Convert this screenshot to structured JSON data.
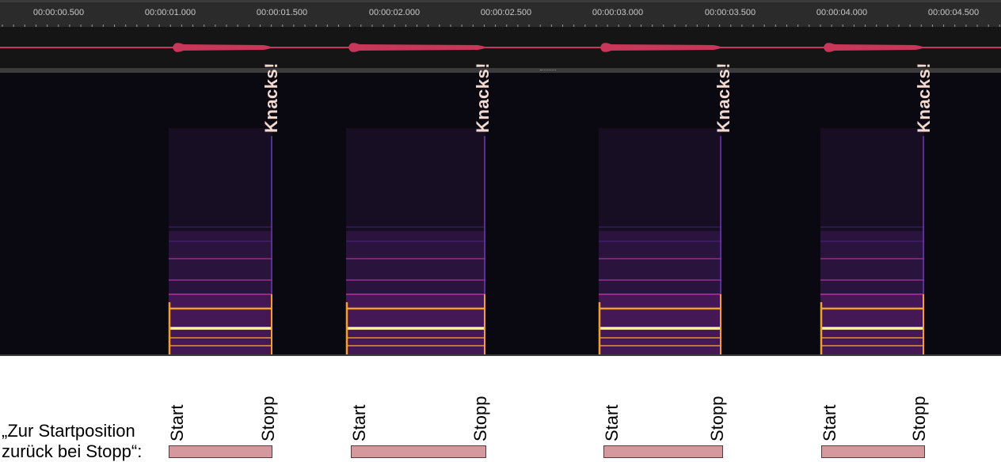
{
  "ruler": {
    "labels": [
      "00:00:00.500",
      "00:00:01.000",
      "00:00:01.500",
      "00:00:02.000",
      "00:00:02.500",
      "00:00:03.000",
      "00:00:03.500",
      "00:00:04.000",
      "00:00:04.500"
    ]
  },
  "waveform": {
    "color": "#c8365a"
  },
  "spectrogram": {
    "annotation": "Knacks!",
    "segments": [
      {
        "start_label": "Start",
        "stop_label": "Stopp"
      },
      {
        "start_label": "Start",
        "stop_label": "Stopp"
      },
      {
        "start_label": "Start",
        "stop_label": "Stopp"
      },
      {
        "start_label": "Start",
        "stop_label": "Stopp"
      }
    ]
  },
  "caption": {
    "line1": "„Zur Startposition",
    "line2": "zurück bei Stopp“:"
  },
  "colors": {
    "bar_fill": "#d4989d",
    "band_hot": "#fff3a0",
    "band_warm": "#f0a030",
    "band_mid": "#b0309a",
    "band_cool": "#5a2a9a"
  }
}
